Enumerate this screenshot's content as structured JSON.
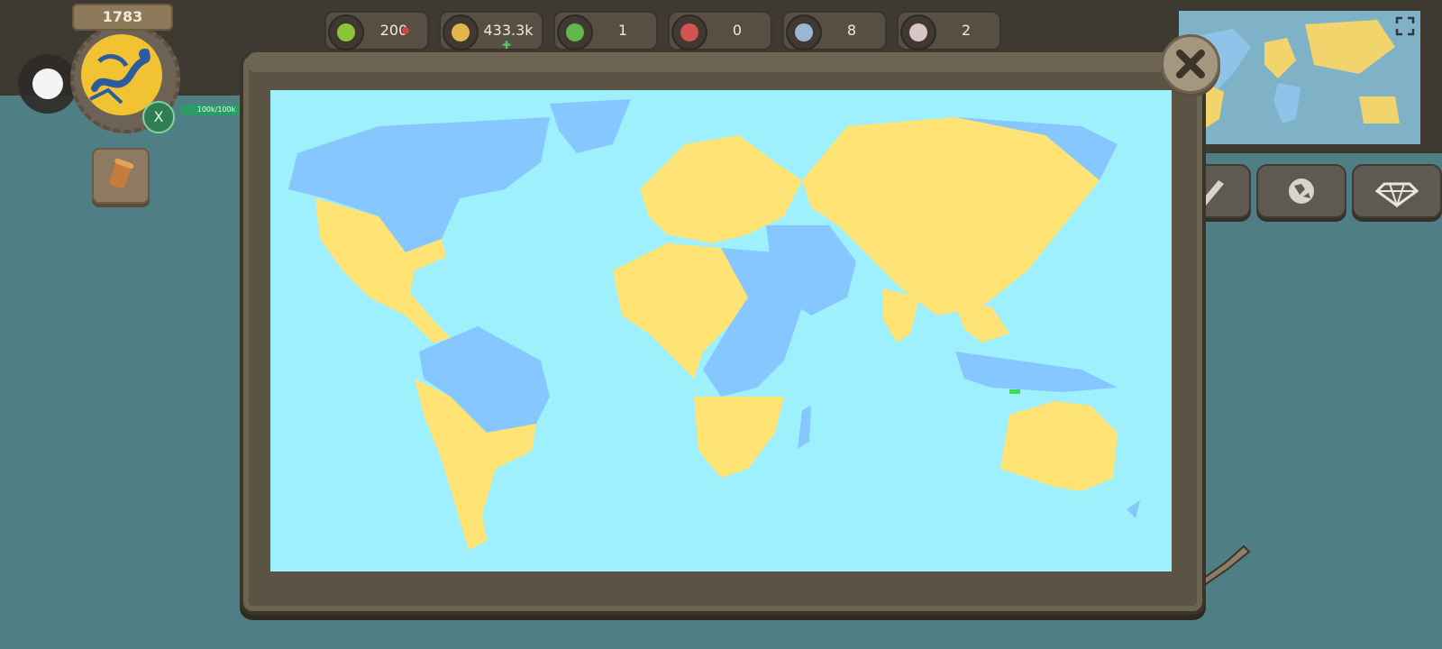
{
  "hud": {
    "year": "1783",
    "x_button": "X",
    "hp_text": "100k/100k"
  },
  "resources": [
    {
      "id": "happiness",
      "icon": "smiley-icon",
      "value": "200",
      "color": "#8cc43b"
    },
    {
      "id": "gold",
      "icon": "coins-icon",
      "value": "433.3k",
      "color": "#e2b64b"
    },
    {
      "id": "allies",
      "icon": "green-crown-icon",
      "value": "1",
      "color": "#62b84f"
    },
    {
      "id": "enemies",
      "icon": "red-crown-icon",
      "value": "0",
      "color": "#d45252"
    },
    {
      "id": "neutral",
      "icon": "blue-crown-icon",
      "value": "8",
      "color": "#9cb7d6"
    },
    {
      "id": "treaties",
      "icon": "treaty-icon",
      "value": "2",
      "color": "#d9c6c6"
    }
  ],
  "map_colors": {
    "ocean": "#9ff0fd",
    "player": "#ffe375",
    "other": "#86c7ff",
    "highlight": "#3ddc52"
  },
  "right_buttons": [
    {
      "id": "edit",
      "icon": "pencil-icon"
    },
    {
      "id": "globe",
      "icon": "globe-icon"
    },
    {
      "id": "gems",
      "icon": "diamond-icon"
    }
  ]
}
